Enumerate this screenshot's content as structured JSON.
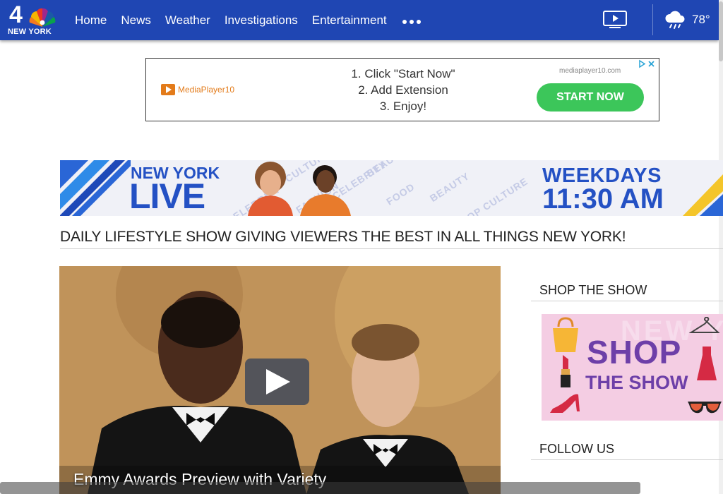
{
  "header": {
    "logo_number": "4",
    "logo_city": "NEW YORK",
    "nav": [
      "Home",
      "News",
      "Weather",
      "Investigations",
      "Entertainment"
    ],
    "more_icon": "more-dots-icon",
    "tv_icon": "tv-play-icon",
    "weather_icon": "rain-cloud-icon",
    "temperature": "78°"
  },
  "ad": {
    "brand": "MediaPlayer10",
    "steps": [
      "1. Click \"Start Now\"",
      "2. Add Extension",
      "3. Enjoy!"
    ],
    "domain": "mediaplayer10.com",
    "cta": "START NOW"
  },
  "banner": {
    "line1": "NEW YORK",
    "line2": "LIVE",
    "schedule_day": "WEEKDAYS",
    "schedule_time": "11:30 AM",
    "bg_words": [
      "FASHION",
      "CELEBRITY",
      "FOOD",
      "BEAUTY",
      "POP CULTURE"
    ]
  },
  "headline": "DAILY LIFESTYLE SHOW GIVING VIEWERS THE BEST IN ALL THINGS NEW YORK!",
  "video": {
    "caption": "Emmy Awards Preview with Variety"
  },
  "sidebar": {
    "shop_title": "SHOP THE SHOW",
    "shop_word": "SHOP",
    "shop_sub": "THE SHOW",
    "shop_bg": "NEW YORK LIVE",
    "follow_title": "FOLLOW US"
  },
  "colors": {
    "nav_blue": "#1f46b3",
    "brand_blue": "#2451c4",
    "cta_green": "#3cc65a",
    "shop_purple": "#6d3fa8"
  }
}
